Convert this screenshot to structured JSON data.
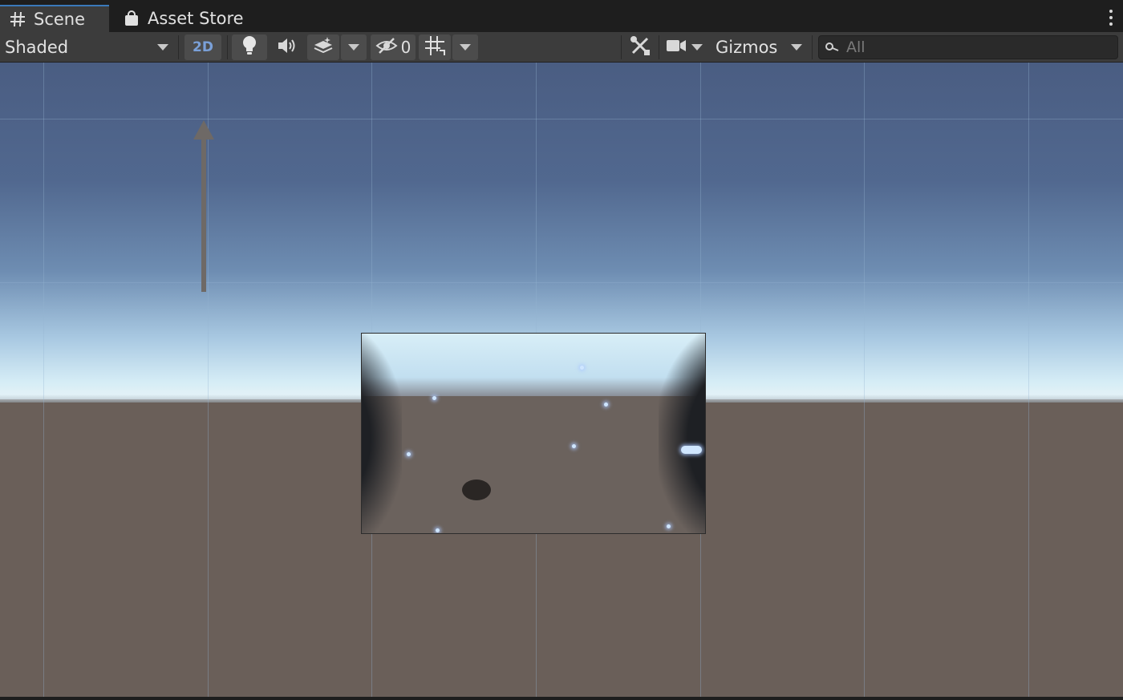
{
  "tabs": [
    {
      "label": "Scene",
      "icon": "scene-grid-icon",
      "active": true
    },
    {
      "label": "Asset Store",
      "icon": "shopping-bag-icon",
      "active": false
    }
  ],
  "toolbar": {
    "shading_mode": "Shaded",
    "two_d_label": "2D",
    "hidden_count": "0",
    "gizmos_label": "Gizmos",
    "search_placeholder": "All"
  },
  "colors": {
    "two_d_text": "#7aa0d8",
    "active_tab_accent": "#3a79bb",
    "annotation_arrow": "#6e6966"
  }
}
